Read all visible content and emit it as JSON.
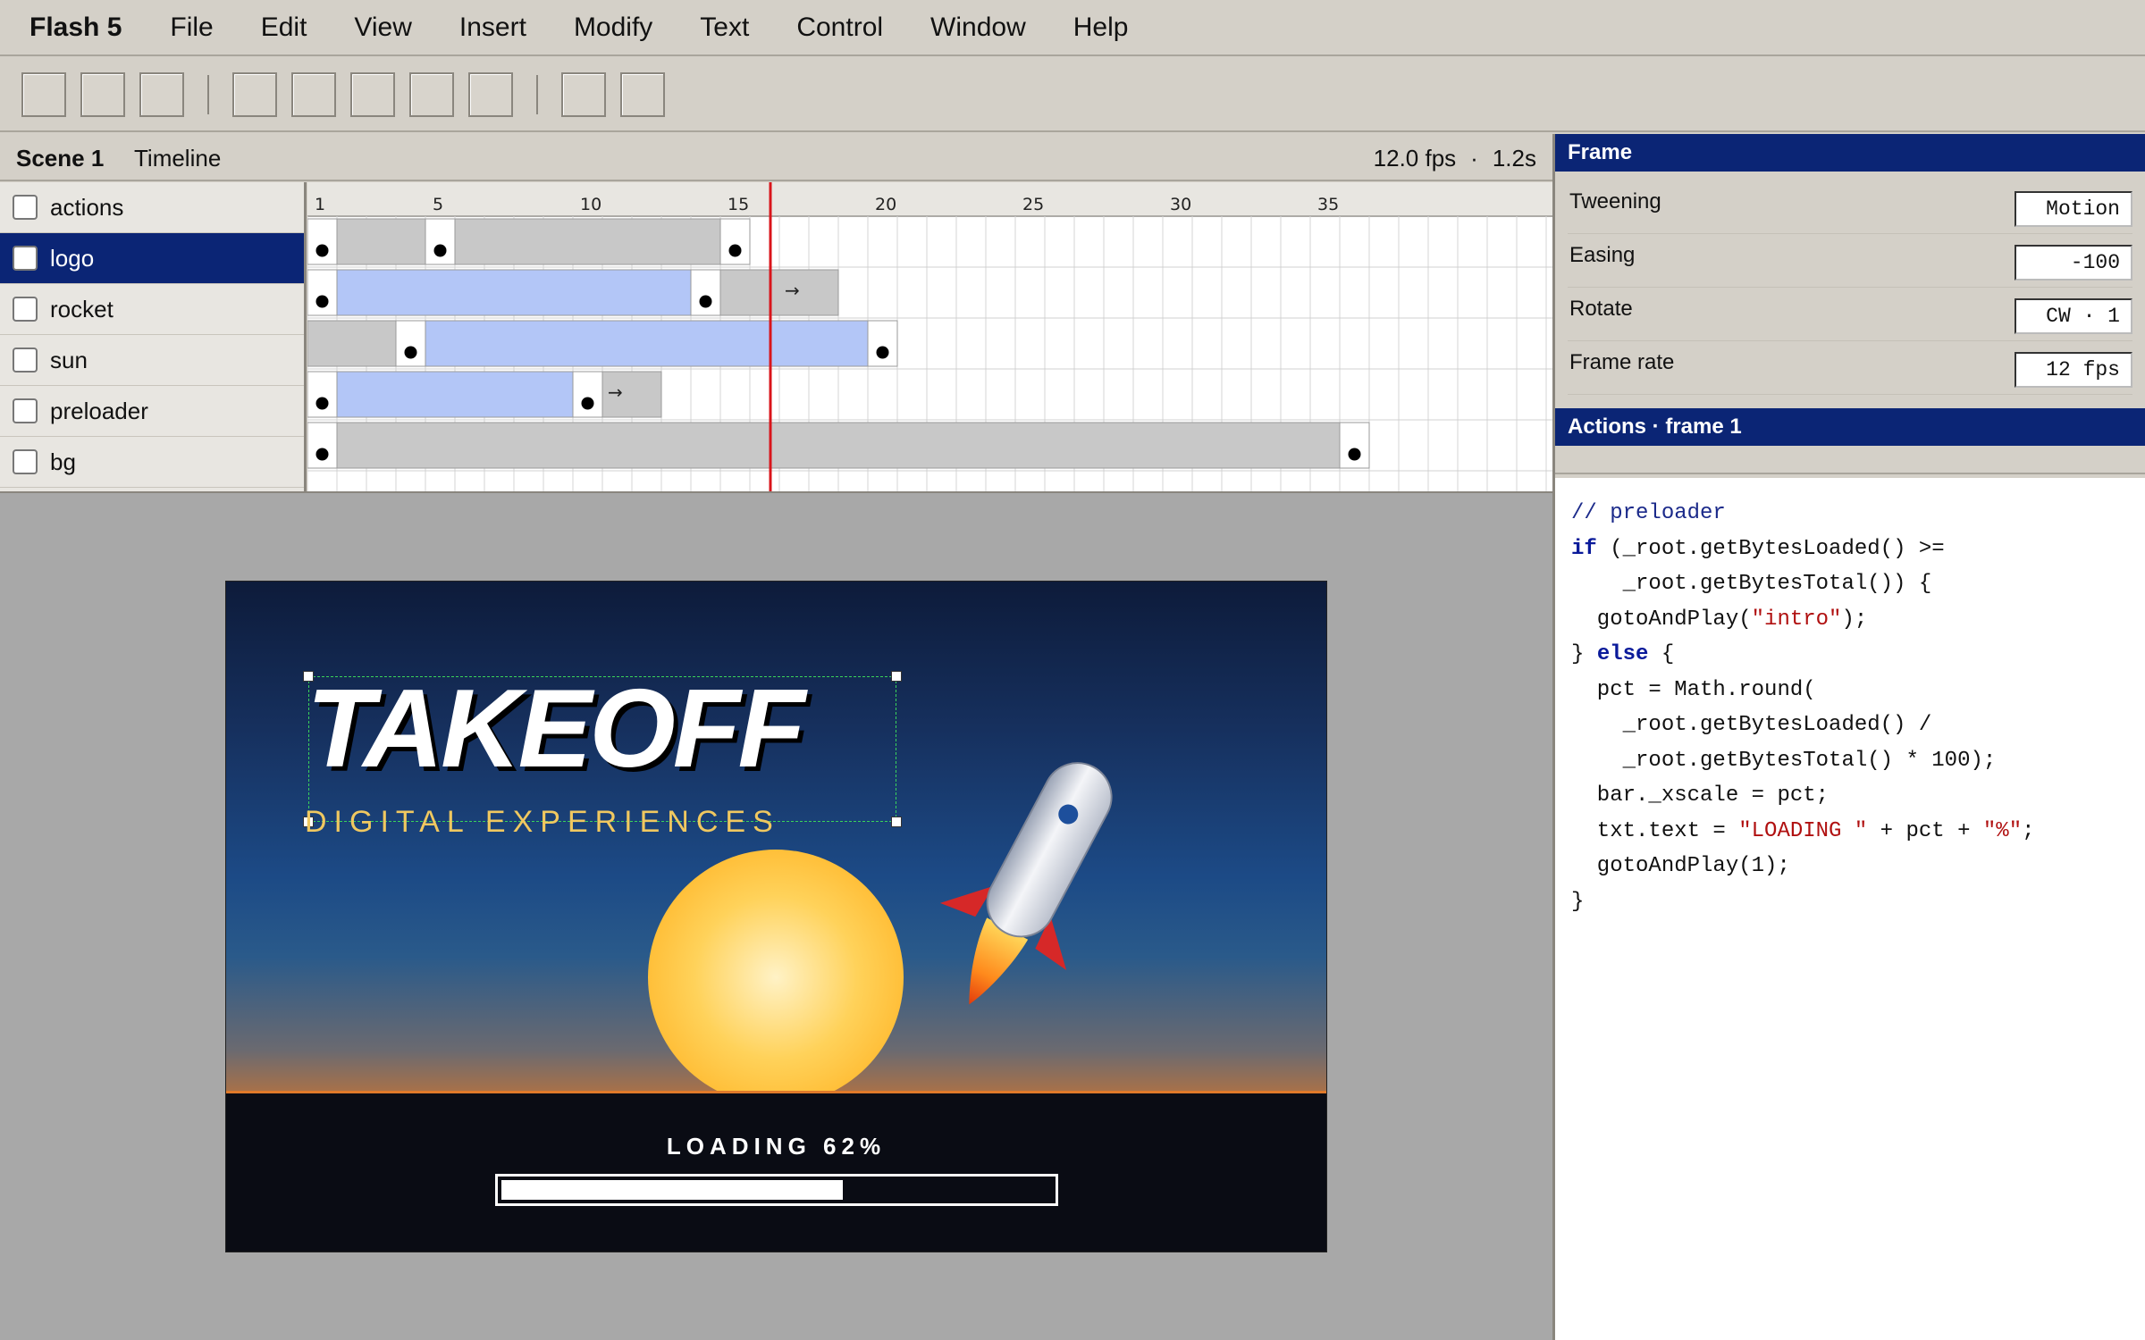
{
  "menubar": {
    "app_name": "Flash 5",
    "items": [
      "File",
      "Edit",
      "View",
      "Insert",
      "Modify",
      "Text",
      "Control",
      "Window",
      "Help"
    ]
  },
  "timeline": {
    "scene": "Scene 1",
    "label": "Timeline",
    "fps": "12.0 fps",
    "separator": "·",
    "duration": "1.2s",
    "ruler": [
      "1",
      "5",
      "10",
      "15",
      "20",
      "25",
      "30",
      "35"
    ],
    "playhead_frame": 15,
    "layers": [
      {
        "name": "actions",
        "selected": false
      },
      {
        "name": "logo",
        "selected": true
      },
      {
        "name": "rocket",
        "selected": false
      },
      {
        "name": "sun",
        "selected": false
      },
      {
        "name": "preloader",
        "selected": false
      },
      {
        "name": "bg",
        "selected": false
      }
    ]
  },
  "stage": {
    "title": "TAKEOFF",
    "subtitle": "DIGITAL EXPERIENCES",
    "loading_text": "LOADING 62%",
    "progress": 0.62
  },
  "frame_panel": {
    "title": "Frame",
    "props": [
      {
        "label": "Tweening",
        "value": "Motion"
      },
      {
        "label": "Easing",
        "value": "-100"
      },
      {
        "label": "Rotate",
        "value": "CW · 1"
      },
      {
        "label": "Frame rate",
        "value": "12 fps"
      }
    ]
  },
  "actions_panel": {
    "title": "Actions · frame 1",
    "code": {
      "l1": "// preloader",
      "l2_kw": "if",
      "l2": " (_root.getBytesLoaded() >=",
      "l3": "    _root.getBytesTotal()) {",
      "l4a": "  gotoAndPlay(",
      "l4s": "\"intro\"",
      "l4b": ");",
      "l5a": "} ",
      "l5kw": "else",
      "l5b": " {",
      "l6": "  pct = Math.round(",
      "l7": "    _root.getBytesLoaded() /",
      "l8": "    _root.getBytesTotal() * 100);",
      "l9": "  bar._xscale = pct;",
      "l10a": "  txt.text = ",
      "l10s1": "\"LOADING \"",
      "l10b": " + pct + ",
      "l10s2": "\"%\"",
      "l10c": ";",
      "l11": "  gotoAndPlay(1);",
      "l12": "}"
    }
  },
  "colors": {
    "selection": "#0b2575",
    "tween": "#b3c6f7",
    "static_frame": "#c8c8c8",
    "playhead": "#d9151b"
  }
}
